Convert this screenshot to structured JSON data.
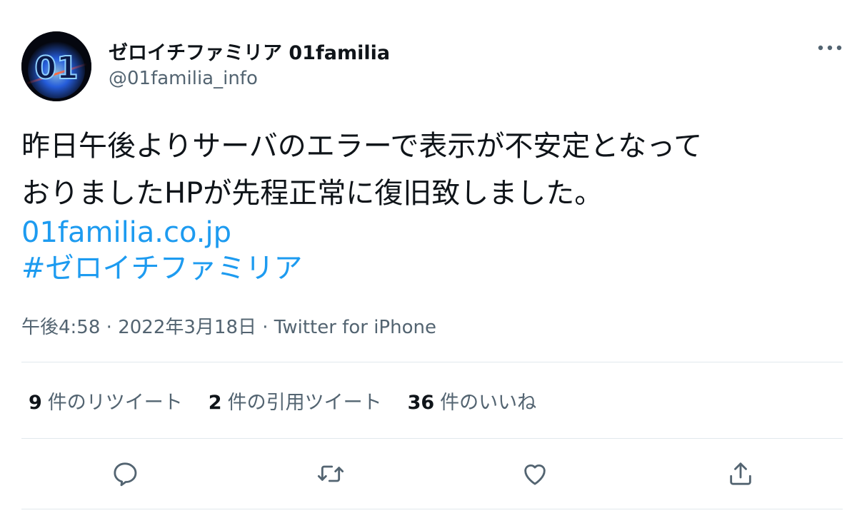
{
  "user": {
    "display_name": "ゼロイチファミリア 01familia",
    "handle": "@01familia_info",
    "avatar_text": "01"
  },
  "tweet": {
    "text_lines": [
      "昨日午後よりサーバのエラーで表示が不安定となって",
      "おりましたHPが先程正常に復旧致しました。"
    ],
    "link": "01familia.co.jp",
    "hashtag": "#ゼロイチファミリア"
  },
  "meta": {
    "time": "午後4:58",
    "date": "2022年3月18日",
    "source": "Twitter for iPhone",
    "separator": "·"
  },
  "stats": {
    "retweets_count": "9",
    "retweets_label": "件のリツイート",
    "quotes_count": "2",
    "quotes_label": "件の引用ツイート",
    "likes_count": "36",
    "likes_label": "件のいいね"
  },
  "colors": {
    "link": "#1d9bf0",
    "text": "#0f1419",
    "secondary": "#536471",
    "divider": "#e1e8ed"
  },
  "icons": {
    "more": "more-icon",
    "reply": "reply-icon",
    "retweet": "retweet-icon",
    "like": "heart-icon",
    "share": "share-icon"
  }
}
